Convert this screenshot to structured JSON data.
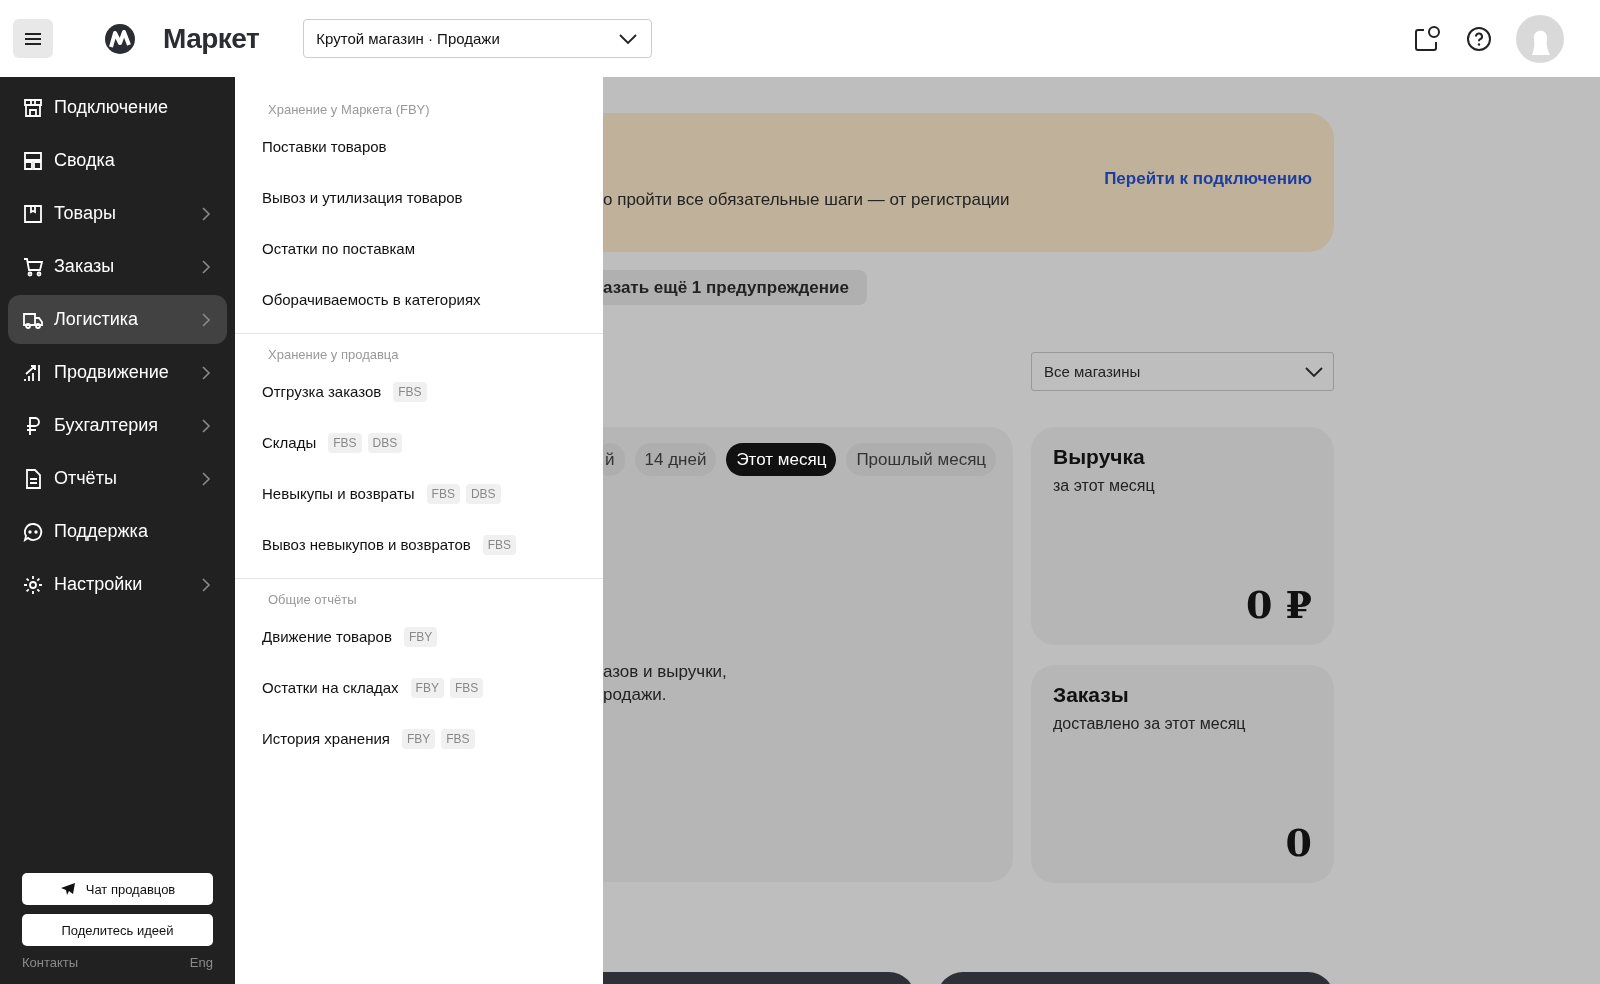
{
  "header": {
    "logo": "Маркет",
    "store_select": "Крутой магазин  · Продажи"
  },
  "sidebar": {
    "items": [
      {
        "label": "Подключение",
        "selected": false,
        "expandable": false
      },
      {
        "label": "Сводка",
        "selected": false,
        "expandable": false
      },
      {
        "label": "Товары",
        "selected": false,
        "expandable": true
      },
      {
        "label": "Заказы",
        "selected": false,
        "expandable": true
      },
      {
        "label": "Логистика",
        "selected": true,
        "expandable": true
      },
      {
        "label": "Продвижение",
        "selected": false,
        "expandable": true
      },
      {
        "label": "Бухгалтерия",
        "selected": false,
        "expandable": true
      },
      {
        "label": "Отчёты",
        "selected": false,
        "expandable": true
      },
      {
        "label": "Поддержка",
        "selected": false,
        "expandable": false
      },
      {
        "label": "Настройки",
        "selected": false,
        "expandable": true
      }
    ],
    "buttons": [
      "Чат продавцов",
      "Поделитесь идеей"
    ],
    "footer_links": [
      "Контакты",
      "Eng"
    ]
  },
  "flyout": {
    "sections": [
      {
        "title": "Хранение у Маркета (FBY)",
        "items": [
          {
            "label": "Поставки товаров"
          },
          {
            "label": "Вывоз и утилизация товаров"
          },
          {
            "label": "Остатки по поставкам"
          },
          {
            "label": "Оборачиваемость в категориях"
          }
        ]
      },
      {
        "title": "Хранение у продавца",
        "items": [
          {
            "label": "Отгрузка заказов",
            "tags": [
              "FBS"
            ]
          },
          {
            "label": "Склады",
            "tags": [
              "FBS",
              "DBS"
            ]
          },
          {
            "label": "Невыкупы и возвраты",
            "tags": [
              "FBS",
              "DBS"
            ]
          },
          {
            "label": "Вывоз невыкупов и возвратов",
            "tags": [
              "FBS"
            ]
          }
        ]
      },
      {
        "title": "Общие отчёты",
        "items": [
          {
            "label": "Движение товаров",
            "tags": [
              "FBY"
            ]
          },
          {
            "label": "Остатки на складах",
            "tags": [
              "FBY",
              "FBS"
            ]
          },
          {
            "label": "История хранения",
            "tags": [
              "FBY",
              "FBS"
            ]
          }
        ]
      }
    ]
  },
  "main": {
    "banner": {
      "text": "о пройти все обязательные шаги — от регистрации",
      "link": "Перейти к подключению"
    },
    "more_warnings": "азать ещё 1 предупреждение",
    "store_filter": "Все магазины",
    "periods": [
      {
        "label": "й",
        "selected": false
      },
      {
        "label": "14 дней",
        "selected": false
      },
      {
        "label": "Этот месяц",
        "selected": true
      },
      {
        "label": "Прошлый месяц",
        "selected": false
      }
    ],
    "empty_text": [
      "азов и выручки,",
      "родажи."
    ],
    "stats": [
      {
        "title": "Выручка",
        "subtitle": "за этот месяц",
        "value": "0 ₽"
      },
      {
        "title": "Заказы",
        "subtitle": "доставлено за этот месяц",
        "value": "0"
      }
    ]
  }
}
